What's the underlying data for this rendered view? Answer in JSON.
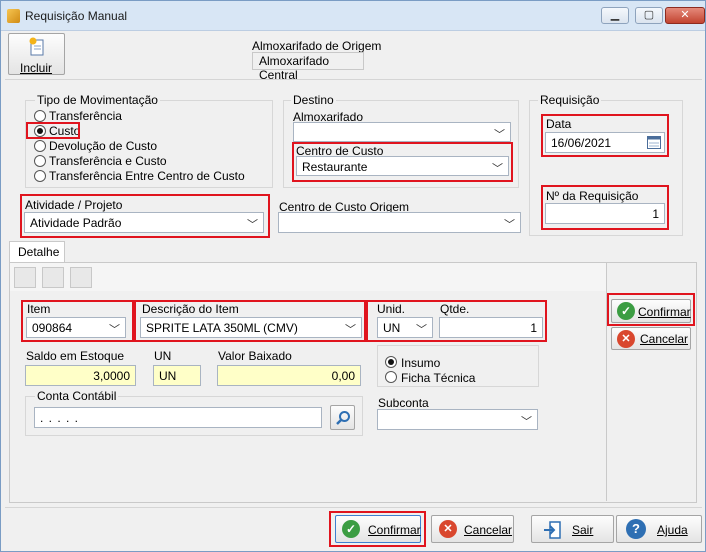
{
  "window": {
    "title": "Requisição Manual",
    "min": "▁",
    "max": "▢",
    "close": "✕"
  },
  "toolbar": {
    "incluir": "Incluir"
  },
  "almox_origem": {
    "label": "Almoxarifado de Origem",
    "value": "Almoxarifado Central"
  },
  "tipo": {
    "label": "Tipo de Movimentação",
    "options": [
      "Transferência",
      "Custo",
      "Devolução de Custo",
      "Transferência e Custo",
      "Transferência Entre Centro de Custo"
    ],
    "selected": 1
  },
  "destino": {
    "label": "Destino",
    "almox_label": "Almoxarifado",
    "almox_value": "",
    "centro_label": "Centro de Custo",
    "centro_value": "Restaurante"
  },
  "requisicao": {
    "label": "Requisição",
    "data_label": "Data",
    "data_value": "16/06/2021",
    "numero_label": "Nº  da Requisição",
    "numero_value": "1"
  },
  "atividade": {
    "label": "Atividade / Projeto",
    "value": "Atividade Padrão"
  },
  "centro_origem": {
    "label": "Centro de Custo Origem",
    "value": ""
  },
  "detalhe": {
    "tab": "Detalhe",
    "item_label": "Item",
    "item_value": "090864",
    "desc_label": "Descrição do Item",
    "desc_value": "SPRITE LATA 350ML (CMV)",
    "unid_label": "Unid.",
    "unid_value": "UN",
    "qtde_label": "Qtde.",
    "qtde_value": "1",
    "saldo_label": "Saldo em Estoque",
    "saldo_value": "3,0000",
    "un_label": "UN",
    "un_value": "UN",
    "valor_label": "Valor Baixado",
    "valor_value": "0,00",
    "insumo": "Insumo",
    "ficha": "Ficha Técnica",
    "conta_label": "Conta Contábil",
    "conta_value": ". . . . .",
    "subconta_label": "Subconta",
    "subconta_value": "",
    "confirmar": "Confirmar",
    "cancelar": "Cancelar"
  },
  "footer": {
    "confirmar": "Confirmar",
    "cancelar": "Cancelar",
    "sair": "Sair",
    "ajuda": "Ajuda"
  },
  "colors": {
    "highlight": "#e0141e",
    "confirm_green": "#3c9d43",
    "cancel_red": "#d9472e",
    "help_blue": "#2e6fb3"
  }
}
